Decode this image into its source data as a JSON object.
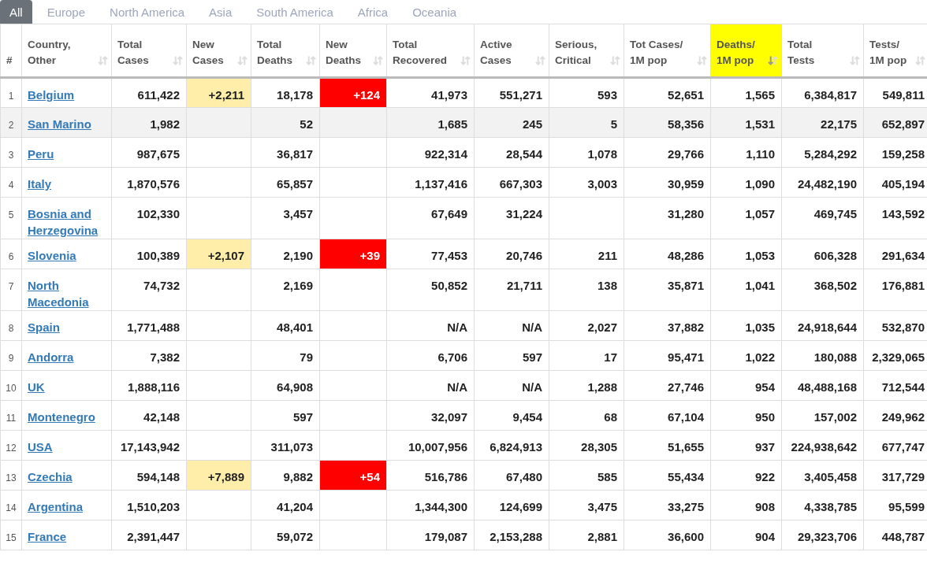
{
  "tabs": [
    {
      "label": "All",
      "selected": true
    },
    {
      "label": "Europe",
      "selected": false
    },
    {
      "label": "North America",
      "selected": false
    },
    {
      "label": "Asia",
      "selected": false
    },
    {
      "label": "South America",
      "selected": false
    },
    {
      "label": "Africa",
      "selected": false
    },
    {
      "label": "Oceania",
      "selected": false
    }
  ],
  "table": {
    "columns": [
      {
        "label": "#",
        "kind": "index",
        "sorted": false,
        "highlighted": false
      },
      {
        "label": "Country,\nOther",
        "kind": "country",
        "sorted": false,
        "highlighted": false
      },
      {
        "label": "Total\nCases",
        "kind": "number",
        "sorted": false,
        "highlighted": false
      },
      {
        "label": "New\nCases",
        "kind": "new_cases",
        "sorted": false,
        "highlighted": false
      },
      {
        "label": "Total\nDeaths",
        "kind": "number",
        "sorted": false,
        "highlighted": false
      },
      {
        "label": "New\nDeaths",
        "kind": "new_deaths",
        "sorted": false,
        "highlighted": false
      },
      {
        "label": "Total\nRecovered",
        "kind": "number",
        "sorted": false,
        "highlighted": false
      },
      {
        "label": "Active\nCases",
        "kind": "number",
        "sorted": false,
        "highlighted": false
      },
      {
        "label": "Serious,\nCritical",
        "kind": "number",
        "sorted": false,
        "highlighted": false
      },
      {
        "label": "Tot Cases/\n1M pop",
        "kind": "number",
        "sorted": false,
        "highlighted": false
      },
      {
        "label": "Deaths/\n1M pop",
        "kind": "number",
        "sorted": true,
        "highlighted": true
      },
      {
        "label": "Total\nTests",
        "kind": "number",
        "sorted": false,
        "highlighted": false
      },
      {
        "label": "Tests/\n1M pop",
        "kind": "number",
        "sorted": false,
        "highlighted": false
      }
    ],
    "rows": [
      {
        "highlighted": false,
        "cells": [
          "1",
          "Belgium",
          "611,422",
          "+2,211",
          "18,178",
          "+124",
          "41,973",
          "551,271",
          "593",
          "52,651",
          "1,565",
          "6,384,817",
          "549,811"
        ]
      },
      {
        "highlighted": true,
        "cells": [
          "2",
          "San Marino",
          "1,982",
          null,
          "52",
          null,
          "1,685",
          "245",
          "5",
          "58,356",
          "1,531",
          "22,175",
          "652,897"
        ]
      },
      {
        "highlighted": false,
        "cells": [
          "3",
          "Peru",
          "987,675",
          null,
          "36,817",
          null,
          "922,314",
          "28,544",
          "1,078",
          "29,766",
          "1,110",
          "5,284,292",
          "159,258"
        ]
      },
      {
        "highlighted": false,
        "cells": [
          "4",
          "Italy",
          "1,870,576",
          null,
          "65,857",
          null,
          "1,137,416",
          "667,303",
          "3,003",
          "30,959",
          "1,090",
          "24,482,190",
          "405,194"
        ]
      },
      {
        "highlighted": false,
        "cells": [
          "5",
          "Bosnia and Herzegovina",
          "102,330",
          null,
          "3,457",
          null,
          "67,649",
          "31,224",
          null,
          "31,280",
          "1,057",
          "469,745",
          "143,592"
        ]
      },
      {
        "highlighted": false,
        "cells": [
          "6",
          "Slovenia",
          "100,389",
          "+2,107",
          "2,190",
          "+39",
          "77,453",
          "20,746",
          "211",
          "48,286",
          "1,053",
          "606,328",
          "291,634"
        ]
      },
      {
        "highlighted": false,
        "cells": [
          "7",
          "North Macedonia",
          "74,732",
          null,
          "2,169",
          null,
          "50,852",
          "21,711",
          "138",
          "35,871",
          "1,041",
          "368,502",
          "176,881"
        ]
      },
      {
        "highlighted": false,
        "cells": [
          "8",
          "Spain",
          "1,771,488",
          null,
          "48,401",
          null,
          "N/A",
          "N/A",
          "2,027",
          "37,882",
          "1,035",
          "24,918,644",
          "532,870"
        ]
      },
      {
        "highlighted": false,
        "cells": [
          "9",
          "Andorra",
          "7,382",
          null,
          "79",
          null,
          "6,706",
          "597",
          "17",
          "95,471",
          "1,022",
          "180,088",
          "2,329,065"
        ]
      },
      {
        "highlighted": false,
        "cells": [
          "10",
          "UK",
          "1,888,116",
          null,
          "64,908",
          null,
          "N/A",
          "N/A",
          "1,288",
          "27,746",
          "954",
          "48,488,168",
          "712,544"
        ]
      },
      {
        "highlighted": false,
        "cells": [
          "11",
          "Montenegro",
          "42,148",
          null,
          "597",
          null,
          "32,097",
          "9,454",
          "68",
          "67,104",
          "950",
          "157,002",
          "249,962"
        ]
      },
      {
        "highlighted": false,
        "cells": [
          "12",
          "USA",
          "17,143,942",
          null,
          "311,073",
          null,
          "10,007,956",
          "6,824,913",
          "28,305",
          "51,655",
          "937",
          "224,938,642",
          "677,747"
        ]
      },
      {
        "highlighted": false,
        "cells": [
          "13",
          "Czechia",
          "594,148",
          "+7,889",
          "9,882",
          "+54",
          "516,786",
          "67,480",
          "585",
          "55,434",
          "922",
          "3,405,458",
          "317,729"
        ]
      },
      {
        "highlighted": false,
        "cells": [
          "14",
          "Argentina",
          "1,510,203",
          null,
          "41,204",
          null,
          "1,344,300",
          "124,699",
          "3,475",
          "33,275",
          "908",
          "4,338,785",
          "95,599"
        ]
      },
      {
        "highlighted": false,
        "cells": [
          "15",
          "France",
          "2,391,447",
          null,
          "59,072",
          null,
          "179,087",
          "2,153,288",
          "2,881",
          "36,600",
          "904",
          "29,323,706",
          "448,787"
        ]
      }
    ]
  }
}
